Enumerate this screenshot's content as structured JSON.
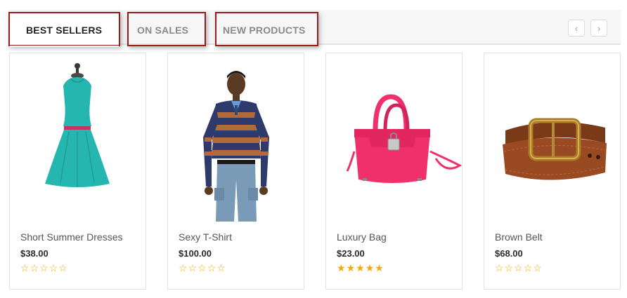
{
  "tabs": [
    {
      "label": "BEST SELLERS",
      "active": true
    },
    {
      "label": "ON SALES",
      "active": false
    },
    {
      "label": "NEW PRODUCTS",
      "active": false
    }
  ],
  "carousel": {
    "prev_icon": "chevron-left-icon",
    "next_icon": "chevron-right-icon",
    "prev_glyph": "‹",
    "next_glyph": "›"
  },
  "products": [
    {
      "name": "Short Summer Dresses",
      "price": "$38.00",
      "rating": 0,
      "image": "dress-image"
    },
    {
      "name": "Sexy T-Shirt",
      "price": "$100.00",
      "rating": 0,
      "image": "sweater-model-image"
    },
    {
      "name": "Luxury Bag",
      "price": "$23.00",
      "rating": 5,
      "image": "pink-bag-image"
    },
    {
      "name": "Brown Belt",
      "price": "$68.00",
      "rating": 0,
      "image": "brown-belt-image"
    }
  ],
  "colors": {
    "accent_star": "#f2a90b",
    "tab_highlight": "#9b1b1b",
    "dress": "#25b6b0",
    "bag": "#f0306a",
    "belt": "#9a4a22"
  }
}
